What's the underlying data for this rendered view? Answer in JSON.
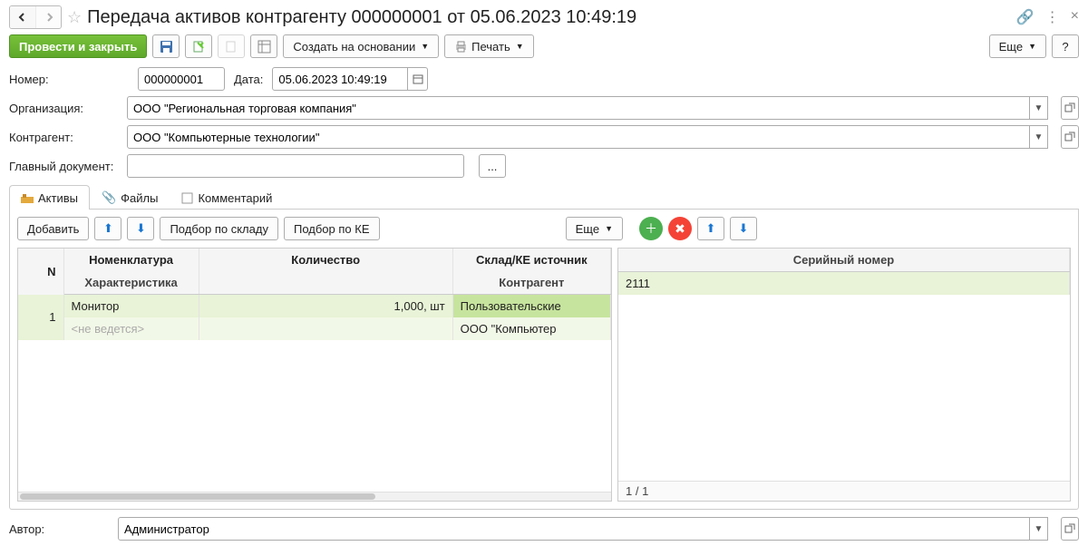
{
  "title": "Передача активов контрагенту 000000001 от 05.06.2023 10:49:19",
  "toolbar": {
    "post_close": "Провести и закрыть",
    "create_based": "Создать на основании",
    "print": "Печать",
    "more": "Еще",
    "help": "?"
  },
  "fields": {
    "number_label": "Номер:",
    "number_value": "000000001",
    "date_label": "Дата:",
    "date_value": "05.06.2023 10:49:19",
    "org_label": "Организация:",
    "org_value": "ООО \"Региональная торговая компания\"",
    "contr_label": "Контрагент:",
    "contr_value": "ООО \"Компьютерные технологии\"",
    "maindoc_label": "Главный документ:",
    "maindoc_value": ""
  },
  "tabs": {
    "assets": "Активы",
    "files": "Файлы",
    "comment": "Комментарий"
  },
  "assets_toolbar": {
    "add": "Добавить",
    "pick_warehouse": "Подбор по складу",
    "pick_ce": "Подбор по КЕ",
    "more": "Еще"
  },
  "grid": {
    "headers": {
      "n": "N",
      "nomen": "Номенклатура",
      "qty": "Количество",
      "source": "Склад/КЕ источник",
      "char": "Характеристика",
      "contr": "Контрагент"
    },
    "rows": [
      {
        "n": "1",
        "nomen": "Монитор",
        "char": "<не ведется>",
        "qty": "1,000, шт",
        "source": "Пользовательские",
        "contr": "ООО \"Компьютер"
      }
    ]
  },
  "serial": {
    "header": "Серийный номер",
    "rows": [
      "2111"
    ],
    "pager": "1 / 1"
  },
  "footer": {
    "author_label": "Автор:",
    "author_value": "Администратор"
  },
  "dotdotdot": "..."
}
